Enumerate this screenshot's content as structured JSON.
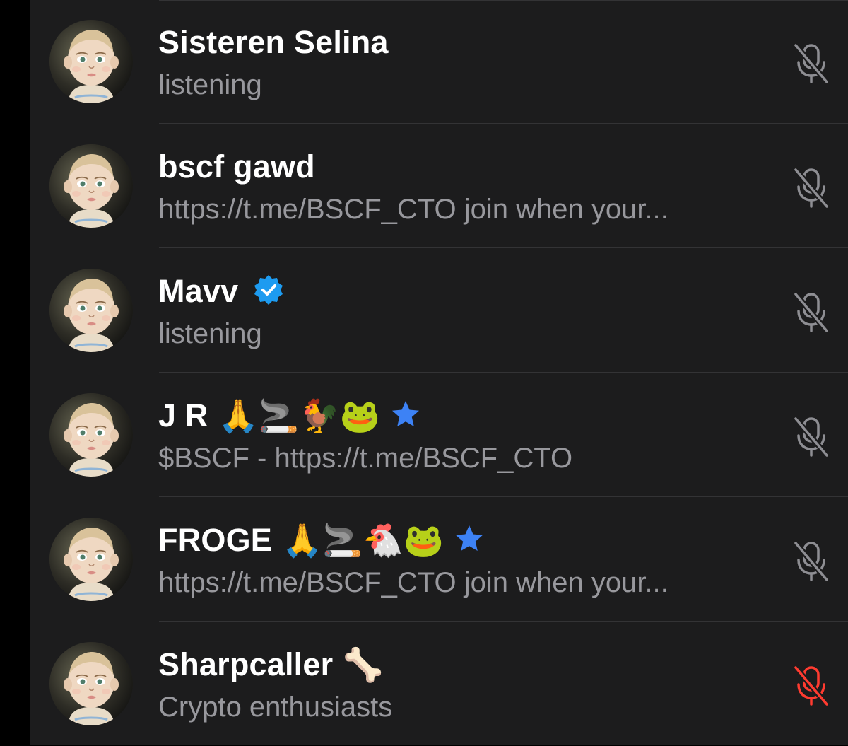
{
  "participants": [
    {
      "name": "Sisteren Selina",
      "subtitle": "listening",
      "badges": [],
      "mic_state": "muted",
      "mic_icon": "mic-muted-icon"
    },
    {
      "name": "bscf gawd",
      "subtitle": "https://t.me/BSCF_CTO join when your...",
      "badges": [],
      "mic_state": "muted",
      "mic_icon": "mic-muted-icon"
    },
    {
      "name": "Mavv",
      "subtitle": "listening",
      "badges": [
        "verified-badge-icon"
      ],
      "mic_state": "muted",
      "mic_icon": "mic-muted-icon"
    },
    {
      "name": "J R",
      "emojis": "🙏🚬🐓🐸",
      "subtitle": "$BSCF - https://t.me/BSCF_CTO",
      "badges": [
        "star-icon"
      ],
      "mic_state": "muted",
      "mic_icon": "mic-muted-icon"
    },
    {
      "name": "FROGE",
      "emojis": "🙏🚬🐔🐸",
      "subtitle": "https://t.me/BSCF_CTO join when your...",
      "badges": [
        "star-icon"
      ],
      "mic_state": "muted",
      "mic_icon": "mic-muted-icon"
    },
    {
      "name": "Sharpcaller",
      "emojis": "🦴",
      "subtitle": "Crypto enthusiasts",
      "badges": [],
      "mic_state": "muted-red",
      "mic_icon": "mic-muted-icon"
    }
  ],
  "colors": {
    "background": "#1c1c1d",
    "name_text": "#ffffff",
    "subtitle_text": "#98989d",
    "mic_muted": "#8e8e93",
    "mic_muted_red": "#ff3b30",
    "verified_blue": "#1d9bf0",
    "star_blue": "#3d82f5"
  }
}
